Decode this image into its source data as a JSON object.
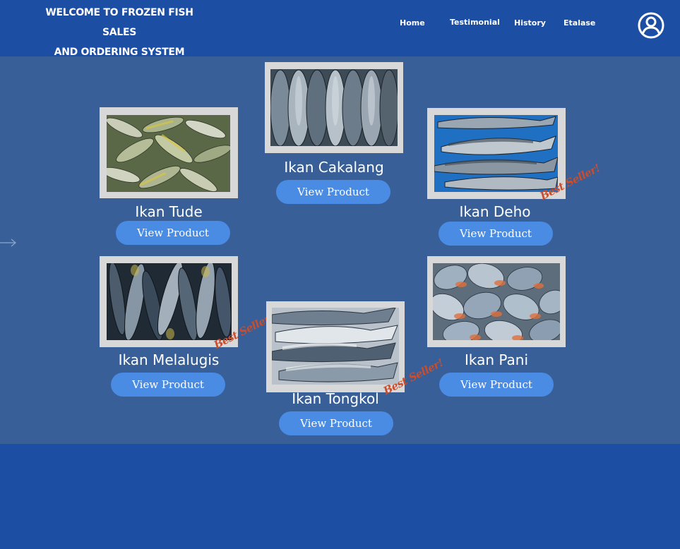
{
  "header": {
    "title_line1": "WELCOME TO FROZEN FISH SALES",
    "title_line2": "AND ORDERING SYSTEM",
    "nav": {
      "home": "Home",
      "testimonial": "Testimonial",
      "history": "History",
      "etalase": "Etalase"
    },
    "profile_icon": "user-circle-icon",
    "background_color": "#1c4fa3"
  },
  "carousel": {
    "prev_icon": "arrow-left-icon"
  },
  "colors": {
    "panel": "#385f97",
    "button": "#4a8be4",
    "badge": "#c94e2e"
  },
  "products": {
    "cakalang": {
      "name": "Ikan Cakalang",
      "button": "View Product"
    },
    "tude": {
      "name": "Ikan Tude",
      "button": "View Product"
    },
    "deho": {
      "name": "Ikan Deho",
      "button": "View Product",
      "badge": "Best Seller!"
    },
    "melalugis": {
      "name": "Ikan Melalugis",
      "button": "View Product",
      "badge": "Best Seller!"
    },
    "tongkol": {
      "name": "Ikan Tongkol",
      "button": "View Product",
      "badge": "Best Seller!"
    },
    "pani": {
      "name": "Ikan Pani",
      "button": "View Product"
    }
  }
}
